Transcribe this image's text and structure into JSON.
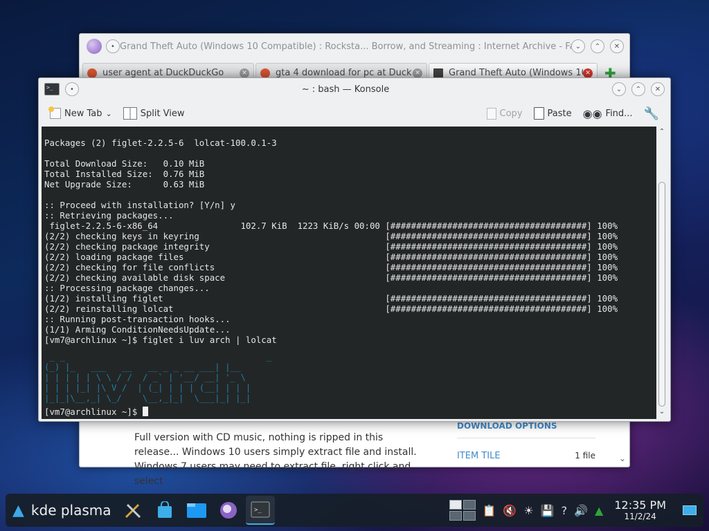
{
  "falkon": {
    "title": "Grand Theft Auto (Windows 10 Compatible) : Rocksta... Borrow, and Streaming : Internet Archive - Falkon",
    "tabs": [
      {
        "label": "user agent at DuckDuckGo",
        "active": false
      },
      {
        "label": "gta 4 download for pc at Duck...",
        "active": false
      },
      {
        "label": "Grand Theft Auto (Windows 10...",
        "active": true
      }
    ],
    "page": {
      "description": "Full version with CD music, nothing is ripped in this release... Windows 10 users simply extract file and install. Windows 7 users may need to extract file, right click and select",
      "download_options_heading": "DOWNLOAD OPTIONS",
      "item_tile_label": "ITEM TILE",
      "item_tile_count": "1 file"
    }
  },
  "konsole": {
    "title": "~ : bash — Konsole",
    "toolbar": {
      "new_tab": "New Tab",
      "split_view": "Split View",
      "copy": "Copy",
      "paste": "Paste",
      "find": "Find..."
    },
    "terminal": {
      "lines": [
        "Packages (2) figlet-2.2.5-6  lolcat-100.0.1-3",
        "",
        "Total Download Size:   0.10 MiB",
        "Total Installed Size:  0.76 MiB",
        "Net Upgrade Size:      0.63 MiB",
        "",
        ":: Proceed with installation? [Y/n] y",
        ":: Retrieving packages...",
        " figlet-2.2.5-6-x86_64                102.7 KiB  1223 KiB/s 00:00 [######################################] 100%",
        "(2/2) checking keys in keyring                                    [######################################] 100%",
        "(2/2) checking package integrity                                  [######################################] 100%",
        "(2/2) loading package files                                       [######################################] 100%",
        "(2/2) checking for file conflicts                                 [######################################] 100%",
        "(2/2) checking available disk space                               [######################################] 100%",
        ":: Processing package changes...",
        "(1/2) installing figlet                                           [######################################] 100%",
        "(2/2) reinstalling lolcat                                         [######################################] 100%",
        ":: Running post-transaction hooks...",
        "(1/1) Arming ConditionNeedsUpdate...",
        "[vm7@archlinux ~]$ figlet i luv arch | lolcat"
      ],
      "figlet_art": " _ _                                       _     \n(_) |_   ___   __   __ _ _ __ ___| |__  \n| | | | | \\ \\ / /  / _` | '__/ __| '_ \\ \n| | | |_| |\\ V /  | (_| | | | (__| | | |\n|_|_|\\__,_| \\_/    \\__,_|_|  \\___|_| |_|",
      "prompt": "[vm7@archlinux ~]$ "
    },
    "scrollbar": {
      "thumb_top_fraction": 0.16,
      "thumb_height_fraction": 0.84
    }
  },
  "panel": {
    "launcher_label": "kde plasma",
    "clock_time": "12:35 PM",
    "clock_date": "11/2/24"
  }
}
